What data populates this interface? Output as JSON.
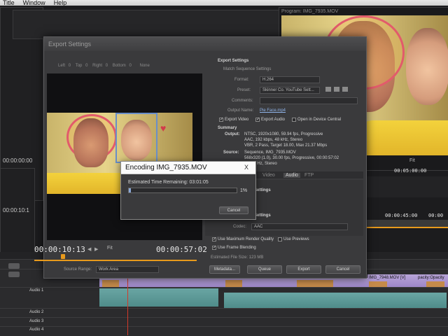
{
  "menubar": {
    "items": [
      "Title",
      "Window",
      "Help"
    ]
  },
  "background": {
    "right_monitor_title": "Program: IMG_7935.MOV",
    "right_monitor_zoom": "Fit",
    "right_tc_1": "00:05:00:00",
    "right_tc_2": "00:00:45:00",
    "right_tc_3": "00:00",
    "left_tc_top": "00:00:00:00",
    "left_tc_bottom": "00:00:10:1",
    "clip_label": "IMG_7948.MOV [V]",
    "clip_label_2": "pacity:Opacity",
    "tracks": [
      "Audio 1",
      "Audio 2",
      "Audio 3",
      "Audio 4"
    ]
  },
  "export": {
    "title": "Export Settings",
    "source_toolbar": [
      "Left",
      "0",
      "Top",
      "0",
      "Right",
      "0",
      "Bottom",
      "0",
      "None"
    ],
    "tc_current": "00:00:10:13",
    "tc_duration": "00:00:57:02",
    "zoom": "Fit",
    "source_range_label": "Source Range:",
    "source_range_value": "Work Area",
    "section_title": "Export Settings",
    "match_sequence": "Match Sequence Settings",
    "format_label": "Format:",
    "format_value": "H.264",
    "preset_label": "Preset:",
    "preset_value": "Skinner Co. YouTube Sett...",
    "comments_label": "Comments:",
    "output_name_label": "Output Name:",
    "output_name_value": "Pie Face.mp4",
    "export_video": "Export Video",
    "export_audio": "Export Audio",
    "open_in_device": "Open in Device Central",
    "summary_title": "Summary",
    "output_label": "Output:",
    "output_lines": [
      "NTSC, 1920x1080, 59.94 fps, Progressive",
      "AAC, 192 kbps, 48 kHz, Stereo",
      "VBR, 2 Pass, Target 18.00, Max 21.37 Mbps"
    ],
    "source_label": "Source:",
    "source_lines": [
      "Sequence, IMG_7935.MOV",
      "568x320 (1.0), 30.00 fps, Progressive, 00:00:57:02",
      "48000 Hz, Stereo"
    ],
    "tabs": [
      "Video",
      "Audio",
      "FTP"
    ],
    "settings_1": "Settings",
    "settings_2": "Settings",
    "codec_label": "Codec:",
    "codec_value": "AAC",
    "use_max_render": "Use Maximum Render Quality",
    "use_previews": "Use Previews",
    "use_frame_blending": "Use Frame Blending",
    "file_size": "Estimated File Size: 123 MB",
    "metadata_btn": "Metadata...",
    "queue_btn": "Queue",
    "export_btn": "Export",
    "cancel_btn": "Cancel"
  },
  "encoding": {
    "title": "Encoding IMG_7935.MOV",
    "close": "X",
    "time_label": "Estimated Time Remaining: 03:01:05",
    "percent": "1%",
    "progress": 0.01,
    "cancel": "Cancel"
  },
  "colors": {
    "accent_orange": "#e89a1c",
    "playhead": "#d23a2a"
  }
}
